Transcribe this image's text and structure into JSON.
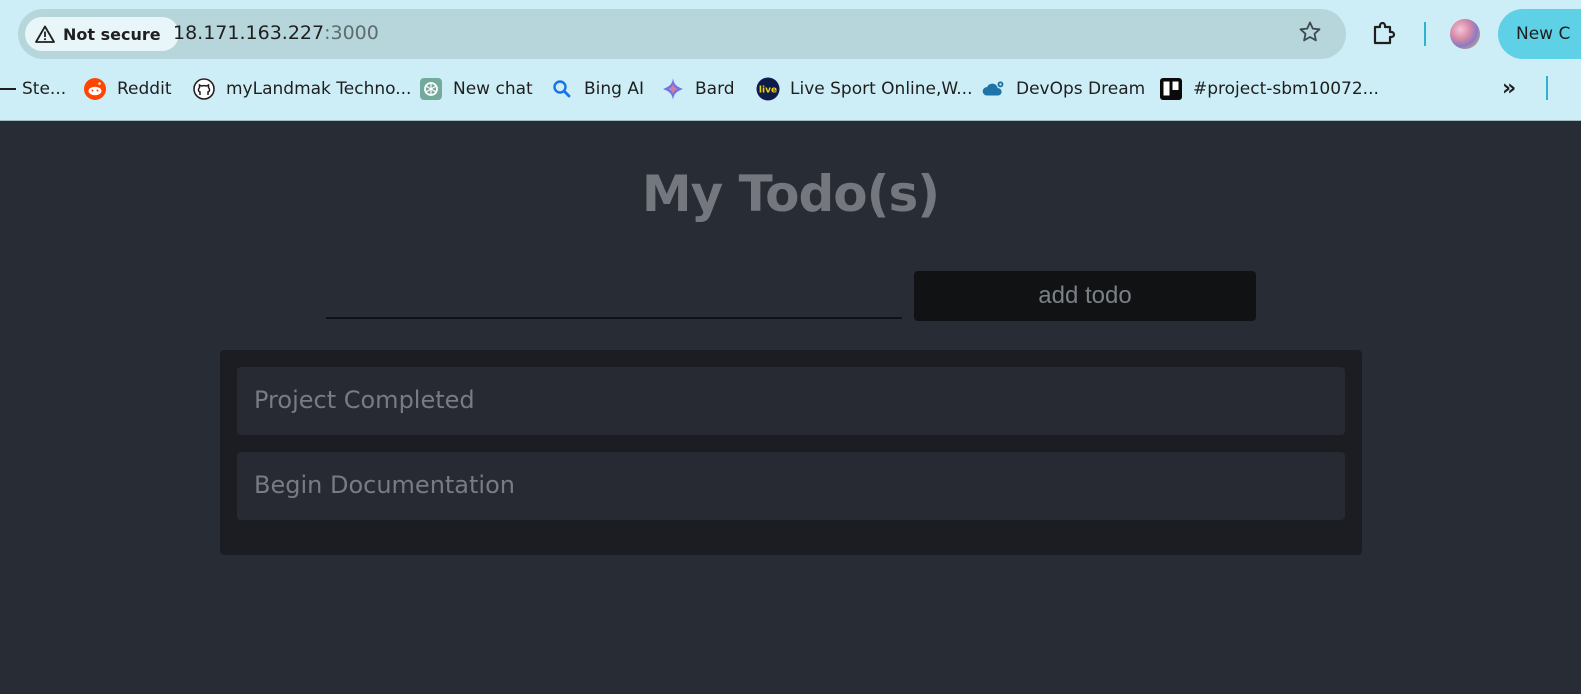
{
  "browser": {
    "security_label": "Not secure",
    "url_host": "18.171.163.227",
    "url_port": ":3000",
    "new_chat_label": "New C",
    "bookmarks": [
      {
        "label": "Ste...",
        "icon": "bookmark-icon"
      },
      {
        "label": "Reddit",
        "icon": "reddit-icon"
      },
      {
        "label": "myLandmak Techno...",
        "icon": "github-icon"
      },
      {
        "label": "New chat",
        "icon": "chatgpt-icon"
      },
      {
        "label": "Bing AI",
        "icon": "search-icon"
      },
      {
        "label": "Bard",
        "icon": "sparkle-icon"
      },
      {
        "label": "Live Sport Online,W...",
        "icon": "live-icon"
      },
      {
        "label": "DevOps Dream",
        "icon": "cloud-gear-icon"
      },
      {
        "label": "#project-sbm10072...",
        "icon": "trello-icon"
      }
    ],
    "overflow_label": "»"
  },
  "page": {
    "title": "My Todo(s)",
    "input_value": "",
    "add_button_label": "add todo",
    "todos": [
      "Project Completed",
      "Begin Documentation"
    ]
  },
  "colors": {
    "chrome_bg": "#cdeef6",
    "page_bg": "#282c34",
    "accent": "#5fd1e6"
  }
}
